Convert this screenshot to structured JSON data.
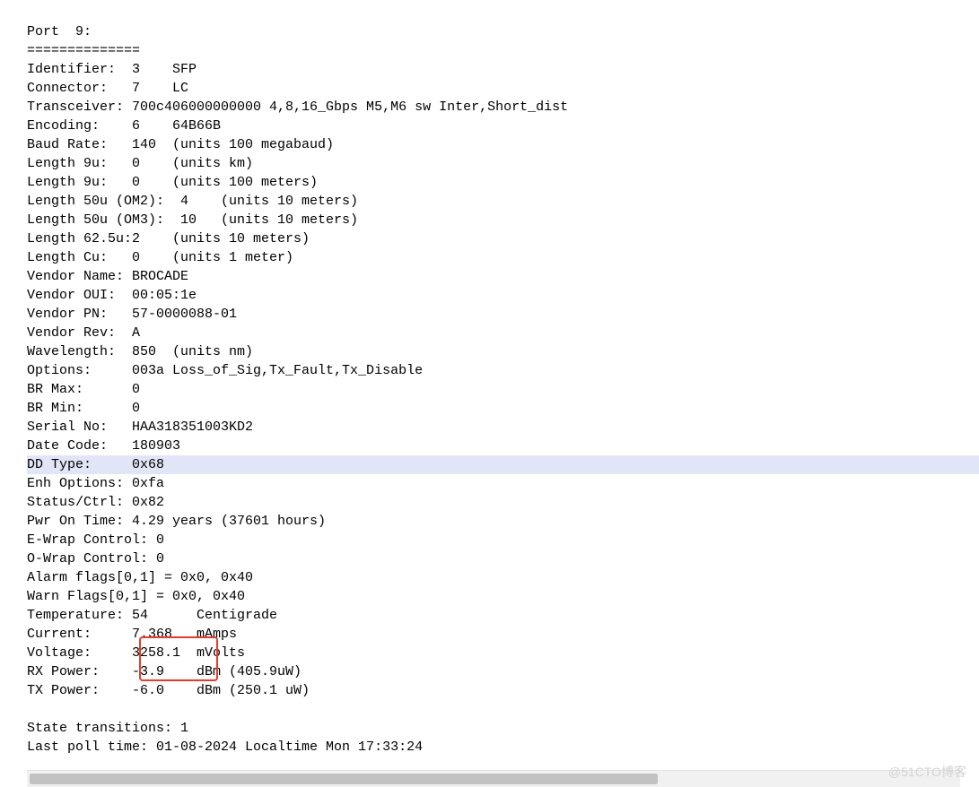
{
  "header": {
    "port_line": "Port  9:",
    "separator": "=============="
  },
  "fields": {
    "identifier": "Identifier:  3    SFP",
    "connector": "Connector:   7    LC",
    "transceiver": "Transceiver: 700c406000000000 4,8,16_Gbps M5,M6 sw Inter,Short_dist",
    "encoding": "Encoding:    6    64B66B",
    "baud_rate": "Baud Rate:   140  (units 100 megabaud)",
    "length_9u_a": "Length 9u:   0    (units km)",
    "length_9u_b": "Length 9u:   0    (units 100 meters)",
    "length_50u_om2": "Length 50u (OM2):  4    (units 10 meters)",
    "length_50u_om3": "Length 50u (OM3):  10   (units 10 meters)",
    "length_625u": "Length 62.5u:2    (units 10 meters)",
    "length_cu": "Length Cu:   0    (units 1 meter)",
    "vendor_name": "Vendor Name: BROCADE",
    "vendor_oui": "Vendor OUI:  00:05:1e",
    "vendor_pn": "Vendor PN:   57-0000088-01",
    "vendor_rev": "Vendor Rev:  A",
    "wavelength": "Wavelength:  850  (units nm)",
    "options": "Options:     003a Loss_of_Sig,Tx_Fault,Tx_Disable",
    "br_max": "BR Max:      0",
    "br_min": "BR Min:      0",
    "serial_no": "Serial No:   HAA318351003KD2",
    "date_code": "Date Code:   180903",
    "dd_type": "DD Type:     0x68",
    "enh_options": "Enh Options: 0xfa",
    "status_ctrl": "Status/Ctrl: 0x82",
    "pwr_on_time": "Pwr On Time: 4.29 years (37601 hours)",
    "ewrap": "E-Wrap Control: 0",
    "owrap": "O-Wrap Control: 0",
    "alarm_flags": "Alarm flags[0,1] = 0x0, 0x40",
    "warn_flags": "Warn Flags[0,1] = 0x0, 0x40",
    "temperature": "Temperature: 54      Centigrade",
    "current": "Current:     7.368   mAmps",
    "voltage": "Voltage:     3258.1  mVolts",
    "rx_power": "RX Power:    -3.9    dBm (405.9uW)",
    "tx_power": "TX Power:    -6.0    dBm (250.1 uW)",
    "blank": "",
    "state_trans": "State transitions: 1",
    "last_poll": "Last poll time: 01-08-2024 Localtime Mon 17:33:24",
    "footer_sep": "=============="
  },
  "highlight_values": {
    "rx_power_value": "-3.9",
    "tx_power_value": "-6.0"
  },
  "watermark": "@51CTO博客"
}
